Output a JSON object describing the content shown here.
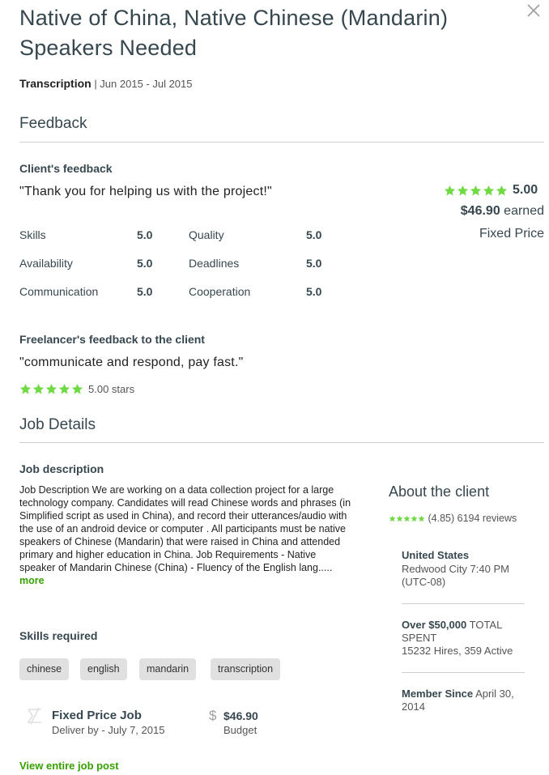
{
  "job": {
    "title": "Native of China, Native Chinese (Mandarin) Speakers Needed",
    "category": "Transcription",
    "period": "| Jun 2015 - Jul 2015"
  },
  "feedback": {
    "heading": "Feedback",
    "client_heading": "Client's feedback",
    "client_quote": "\"Thank you for helping us with the project!\"",
    "rating": "5.00",
    "rating_value": 5.0,
    "earned_amount": "$46.90",
    "earned_label": "earned",
    "price_type": "Fixed Price",
    "scores_left": [
      {
        "label": "Skills",
        "value": "5.0"
      },
      {
        "label": "Availability",
        "value": "5.0"
      },
      {
        "label": "Communication",
        "value": "5.0"
      }
    ],
    "scores_right": [
      {
        "label": "Quality",
        "value": "5.0"
      },
      {
        "label": "Deadlines",
        "value": "5.0"
      },
      {
        "label": "Cooperation",
        "value": "5.0"
      }
    ],
    "freelancer_heading": "Freelancer's feedback to the client",
    "freelancer_quote": "\"communicate and respond, pay fast.\"",
    "freelancer_rating_text": "5.00 stars",
    "freelancer_rating_value": 5.0
  },
  "details": {
    "heading": "Job Details",
    "description_heading": "Job description",
    "description": "Job Description We are working on a data collection project for a large technology company. Candidates will read Chinese words and phrases (in Simplified script as used in China), and record their utterances/audio with the use of an android device or computer . All participants must be native speakers of Chinese (Mandarin) that were raised in China and attended primary and higher education in China. Job Requirements - Native speaker of Mandarin Chinese (China) - Fluency of the English lang.....",
    "more_label": "more",
    "skills_heading": "Skills required",
    "skills": [
      "chinese",
      "english",
      "mandarin",
      "transcription"
    ],
    "job_type": "Fixed Price Job",
    "deliver_by": "Deliver by - July 7, 2015",
    "budget_amount": "$46.90",
    "budget_label": "Budget",
    "view_link": "View entire job post"
  },
  "client": {
    "heading": "About the client",
    "rating_value": 4.85,
    "rating_text": "(4.85) 6194",
    "reviews_label": "reviews",
    "country": "United States",
    "city_time": "Redwood City 7:40 PM (UTC-08)",
    "spent_amount": "Over $50,000",
    "spent_label": "TOTAL SPENT",
    "hires": "15232 Hires, 359 Active",
    "member_label": "Member Since",
    "member_date": "April 30, 2014"
  },
  "colors": {
    "accent_green": "#37a000",
    "star_green": "#6fda44",
    "heading_gray": "#37474f",
    "tag_bg": "#e0e0e0"
  },
  "icons": {
    "close": "close-icon",
    "star": "star-icon",
    "job_type": "fixed-price-icon",
    "budget": "dollar-icon"
  }
}
